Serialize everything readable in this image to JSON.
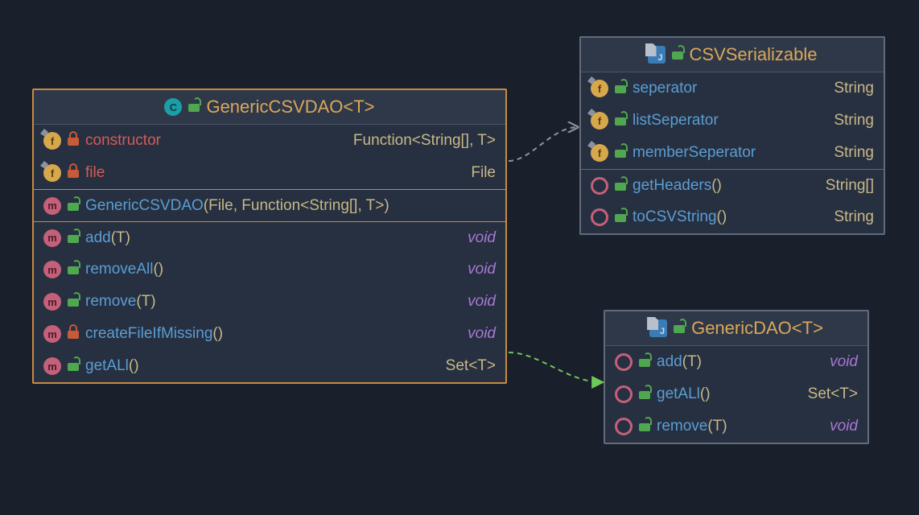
{
  "classes": {
    "genericCSVDAO": {
      "title": "GenericCSVDAO<T>",
      "fields": [
        {
          "name": "constructor",
          "type": "Function<String[], T>",
          "access": "private"
        },
        {
          "name": "file",
          "type": "File",
          "access": "private"
        }
      ],
      "constructors": [
        {
          "name": "GenericCSVDAO",
          "params": "(File, Function<String[], T>)",
          "access": "public"
        }
      ],
      "methods": [
        {
          "name": "add",
          "params": "(T)",
          "return": "void",
          "access": "public"
        },
        {
          "name": "removeAll",
          "params": "()",
          "return": "void",
          "access": "public"
        },
        {
          "name": "remove",
          "params": "(T)",
          "return": "void",
          "access": "public"
        },
        {
          "name": "createFileIfMissing",
          "params": "()",
          "return": "void",
          "access": "private"
        },
        {
          "name": "getALl",
          "params": "()",
          "return": "Set<T>",
          "access": "public"
        }
      ]
    },
    "csvSerializable": {
      "title": "CSVSerializable",
      "fields": [
        {
          "name": "seperator",
          "type": "String",
          "access": "public"
        },
        {
          "name": "listSeperator",
          "type": "String",
          "access": "public"
        },
        {
          "name": "memberSeperator",
          "type": "String",
          "access": "public"
        }
      ],
      "methods": [
        {
          "name": "getHeaders",
          "params": "()",
          "return": "String[]",
          "access": "public"
        },
        {
          "name": "toCSVString",
          "params": "()",
          "return": "String",
          "access": "public"
        }
      ]
    },
    "genericDAO": {
      "title": "GenericDAO<T>",
      "methods": [
        {
          "name": "add",
          "params": "(T)",
          "return": "void",
          "access": "public"
        },
        {
          "name": "getALl",
          "params": "()",
          "return": "Set<T>",
          "access": "public"
        },
        {
          "name": "remove",
          "params": "(T)",
          "return": "void",
          "access": "public"
        }
      ]
    }
  }
}
